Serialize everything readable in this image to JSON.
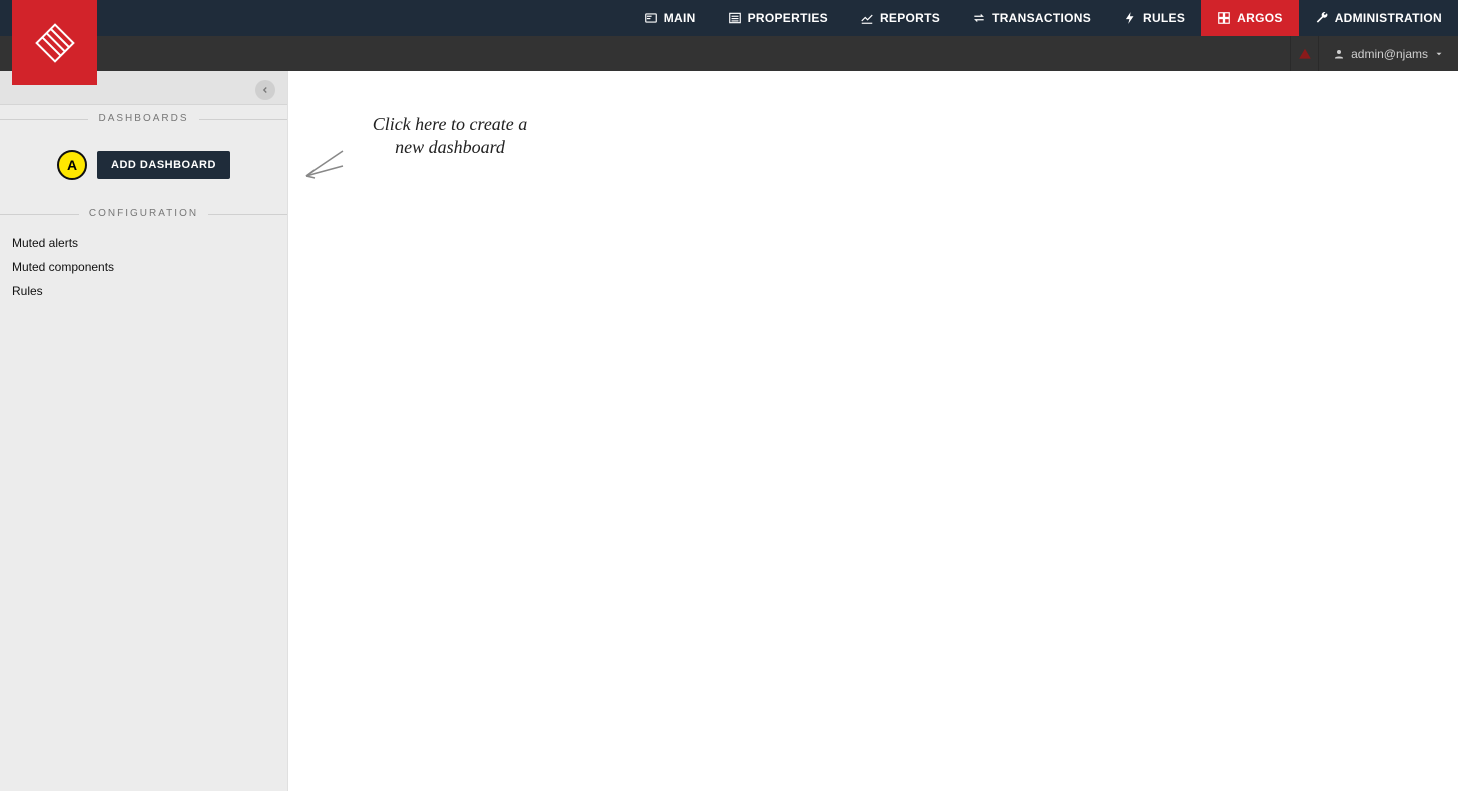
{
  "nav": {
    "items": [
      {
        "label": "MAIN",
        "icon": "card-icon"
      },
      {
        "label": "PROPERTIES",
        "icon": "list-icon"
      },
      {
        "label": "REPORTS",
        "icon": "chart-icon"
      },
      {
        "label": "TRANSACTIONS",
        "icon": "exchange-icon"
      },
      {
        "label": "RULES",
        "icon": "bolt-icon"
      },
      {
        "label": "ARGOS",
        "icon": "dashboard-icon",
        "active": true
      },
      {
        "label": "ADMINISTRATION",
        "icon": "wrench-icon"
      }
    ]
  },
  "user": {
    "name": "admin@njams"
  },
  "sidebar": {
    "sections": {
      "dashboards_header": "DASHBOARDS",
      "configuration_header": "CONFIGURATION"
    },
    "badge_letter": "A",
    "add_dashboard_label": "ADD DASHBOARD",
    "config_items": [
      "Muted alerts",
      "Muted components",
      "Rules"
    ]
  },
  "hint": {
    "line1": "Click here to create a",
    "line2": "new dashboard"
  },
  "colors": {
    "brand_red": "#d2232a",
    "dark_nav": "#1f2c3a",
    "userbar": "#333333",
    "badge_yellow": "#ffe700"
  }
}
